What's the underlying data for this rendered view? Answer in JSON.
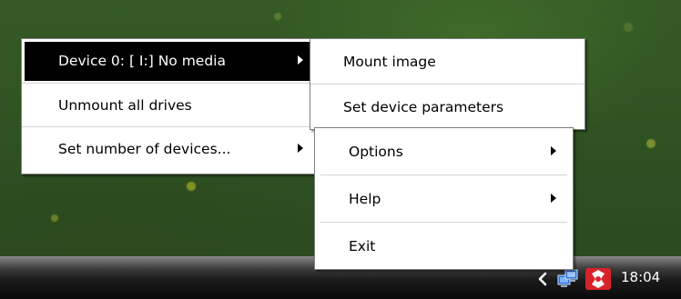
{
  "main_menu": {
    "items": [
      {
        "label": "Device 0: [ I:] No media",
        "has_submenu": true,
        "highlighted": true
      },
      {
        "label": "Unmount all drives",
        "has_submenu": false
      },
      {
        "label": "Set number of devices...",
        "has_submenu": true
      }
    ]
  },
  "device_submenu": {
    "items": [
      {
        "label": "Mount image"
      },
      {
        "label": "Set device parameters"
      }
    ]
  },
  "options_menu": {
    "items": [
      {
        "label": "Options",
        "has_submenu": true
      },
      {
        "label": "Help",
        "has_submenu": true
      },
      {
        "label": "Exit",
        "has_submenu": false
      }
    ]
  },
  "tray": {
    "clock": "18:04",
    "icons": [
      "chevron-left-icon",
      "network-icon",
      "daemon-tools-icon"
    ]
  },
  "colors": {
    "highlight": "#000000",
    "highlight_text": "#ffffff",
    "menu_bg": "#ffffff",
    "taskbar": "#1b1b1b"
  }
}
